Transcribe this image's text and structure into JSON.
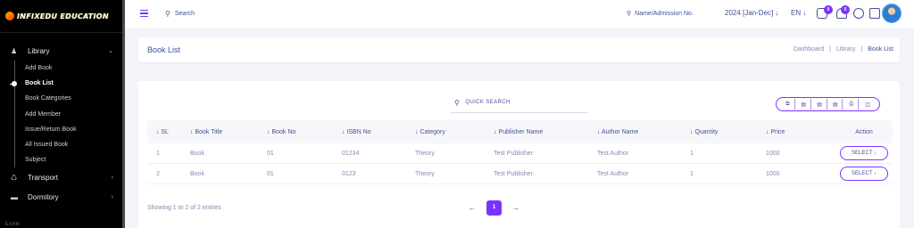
{
  "brand": {
    "name": "INFIXEDU EDUCATION"
  },
  "sidebar": {
    "library": {
      "label": "Library",
      "icon": "library-icon"
    },
    "library_items": [
      {
        "label": "Add Book"
      },
      {
        "label": "Book List",
        "active": true
      },
      {
        "label": "Book Categories"
      },
      {
        "label": "Add Member"
      },
      {
        "label": "Issue/Return Book"
      },
      {
        "label": "All Issued Book"
      },
      {
        "label": "Subject"
      }
    ],
    "transport": {
      "label": "Transport",
      "icon": "bus-icon"
    },
    "dormitory": {
      "label": "Dormitory",
      "icon": "bed-icon"
    },
    "section_label": "EXAM"
  },
  "topbar": {
    "search_label": "Search",
    "name_search_label": "Name/Admission No.",
    "session": "2024 [Jan-Dec] ↓",
    "language": "EN ↓",
    "messages_badge": "0",
    "notifications_badge": "0"
  },
  "header": {
    "title": "Book List",
    "breadcrumb": [
      "Dashboard",
      "|",
      "Library",
      "|",
      "Book List"
    ]
  },
  "list": {
    "quick_search": "QUICK SEARCH",
    "export_buttons": [
      "copy-icon",
      "excel-icon",
      "csv-icon",
      "pdf-icon",
      "print-icon",
      "columns-icon"
    ],
    "columns": [
      "↓ SL",
      "↓ Book Title",
      "↓ Book No",
      "↓ ISBN No",
      "↓ Category",
      "↓ Publisher Name",
      "↓ Author Name",
      "↓ Quantity",
      "↓ Price",
      "Action"
    ],
    "rows": [
      {
        "sl": "1",
        "title": "Book",
        "no": "01",
        "isbn": "01234",
        "category": "Theory",
        "publisher": "Test Publisher",
        "author": "Test Author",
        "quantity": "1",
        "price": "1000",
        "action": "SELECT ↓"
      },
      {
        "sl": "2",
        "title": "Book",
        "no": "01",
        "isbn": "0123",
        "category": "Theory",
        "publisher": "Test Publisher",
        "author": "Test Author",
        "quantity": "1",
        "price": "1000",
        "action": "SELECT ↓"
      }
    ],
    "showing": "Showing 1 to 2 of 2 entries",
    "pager": {
      "prev": "←",
      "current": "1",
      "next": "→"
    }
  },
  "colors": {
    "accent": "#7c32ff",
    "text": "#415094",
    "muted": "#828bb2",
    "sidebar": "#000000"
  }
}
